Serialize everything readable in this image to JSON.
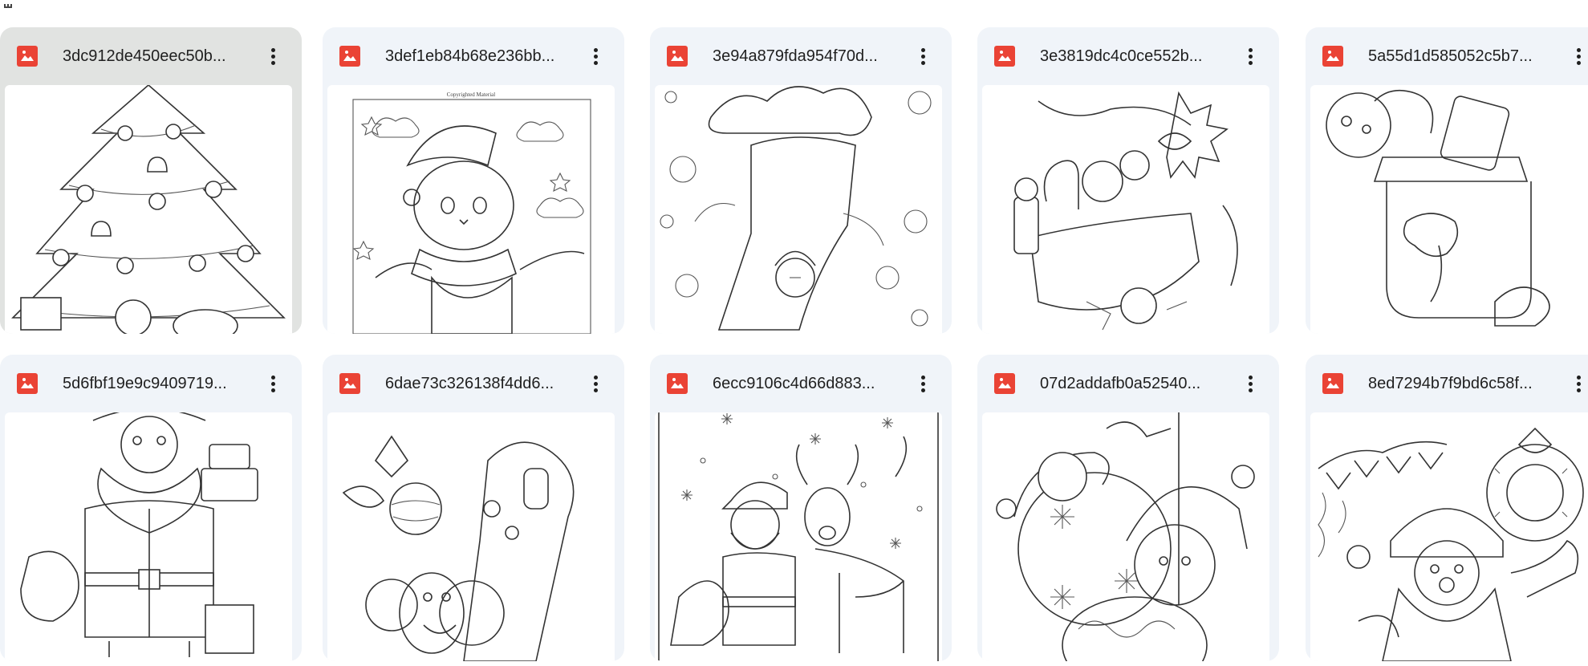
{
  "files": [
    {
      "name": "3dc912de450eec50b...",
      "icon": "image-file-icon",
      "selected": true
    },
    {
      "name": "3def1eb84b68e236bb...",
      "icon": "image-file-icon",
      "caption": "Copyrighted Material"
    },
    {
      "name": "3e94a879fda954f70d...",
      "icon": "image-file-icon"
    },
    {
      "name": "3e3819dc4c0ce552b...",
      "icon": "image-file-icon"
    },
    {
      "name": "5a55d1d585052c5b7...",
      "icon": "image-file-icon"
    },
    {
      "name": "5d6fbf19e9c9409719...",
      "icon": "image-file-icon"
    },
    {
      "name": "6dae73c326138f4dd6...",
      "icon": "image-file-icon"
    },
    {
      "name": "6ecc9106c4d66d883...",
      "icon": "image-file-icon"
    },
    {
      "name": "07d2addafb0a52540...",
      "icon": "image-file-icon"
    },
    {
      "name": "8ed7294b7f9bd6c58f...",
      "icon": "image-file-icon"
    }
  ],
  "colors": {
    "card_bg": "#f0f4f9",
    "card_selected_bg": "#e1e3e1",
    "image_icon": "#ea4335"
  }
}
